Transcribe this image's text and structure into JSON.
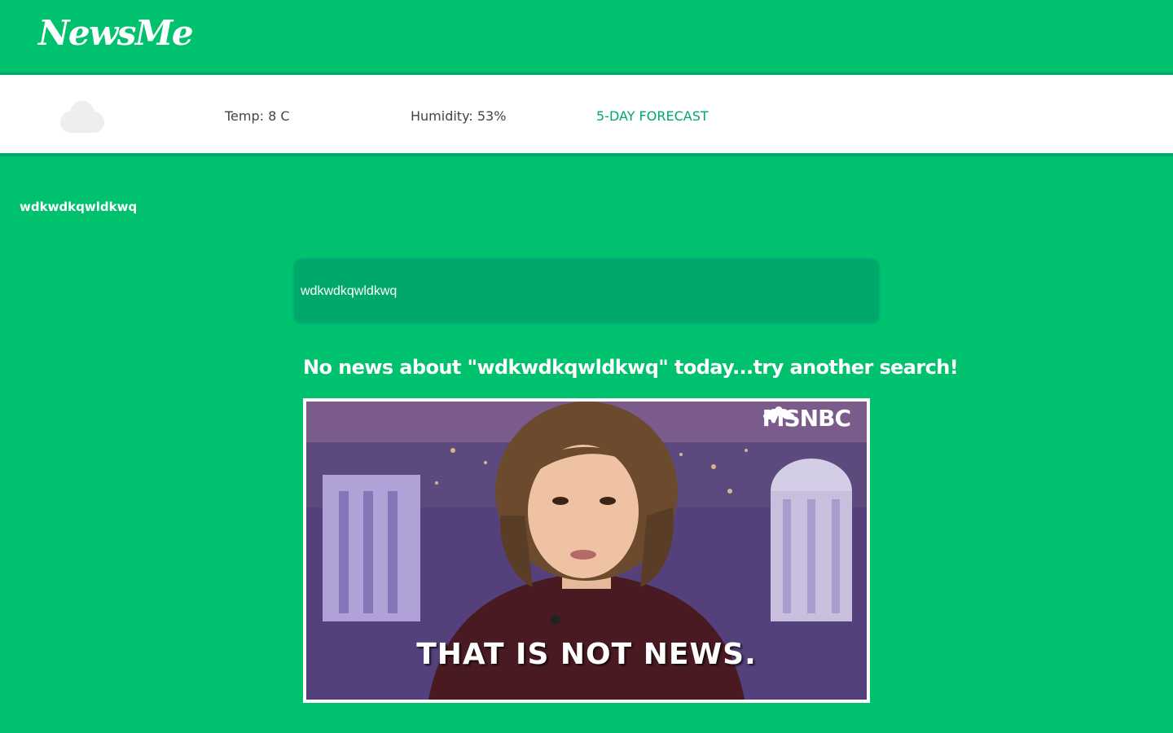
{
  "navbar": {
    "logo": "NewsMe"
  },
  "weather": {
    "icon": "cloud-icon",
    "temp": "Temp: 8 C",
    "humidity": "Humidity: 53%",
    "forecast_link": "5-DAY FORECAST"
  },
  "search": {
    "query_label": "wdkwdkqwldkwq",
    "input_value": "wdkwdkqwldkwq"
  },
  "result": {
    "message": "No news about \"wdkwdkqwldkwq\" today...try another search!",
    "gif": {
      "logo": "MSNBC",
      "caption": "THAT IS NOT NEWS."
    }
  },
  "colors": {
    "brand_green": "#00c16e",
    "dark_green": "#00a86b",
    "white": "#ffffff"
  }
}
